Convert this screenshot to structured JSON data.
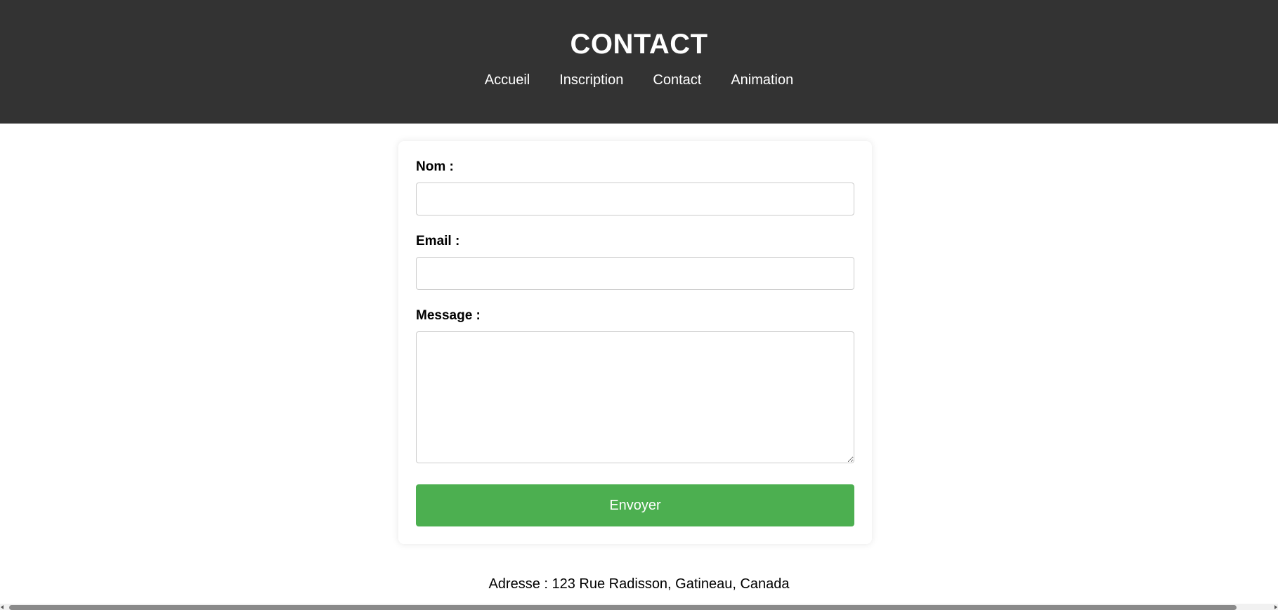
{
  "header": {
    "title": "CONTACT",
    "nav": [
      {
        "label": "Accueil"
      },
      {
        "label": "Inscription"
      },
      {
        "label": "Contact"
      },
      {
        "label": "Animation"
      }
    ]
  },
  "form": {
    "name_label": "Nom :",
    "name_value": "",
    "email_label": "Email :",
    "email_value": "",
    "message_label": "Message :",
    "message_value": "",
    "submit_label": "Envoyer"
  },
  "footer": {
    "address": "Adresse : 123 Rue Radisson, Gatineau, Canada"
  },
  "colors": {
    "header_bg": "#333333",
    "accent": "#4caf50"
  }
}
